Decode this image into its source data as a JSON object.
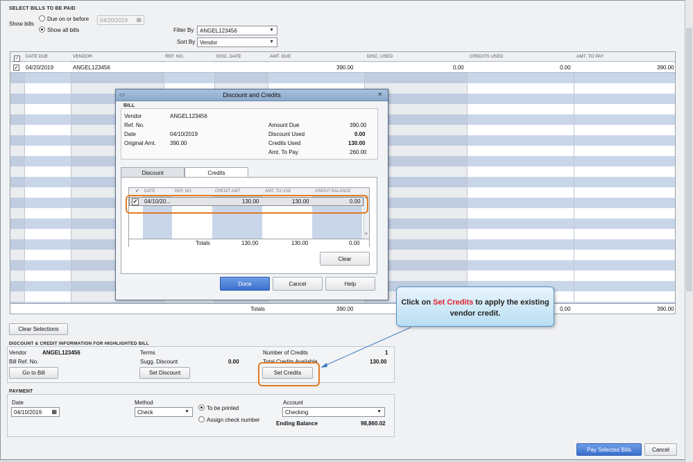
{
  "select_bills": {
    "title": "SELECT BILLS TO BE PAID",
    "show_bills_label": "Show bills",
    "due_option": "Due on or before",
    "due_date": "04/20/2019",
    "all_option": "Show all bills",
    "filter_label": "Filter By",
    "filter_value": "ANGEL123456",
    "sort_label": "Sort By",
    "sort_value": "Vendor"
  },
  "bills_table": {
    "columns": [
      "DATE DUE",
      "VENDOR",
      "REF. NO.",
      "DISC. DATE",
      "AMT. DUE",
      "DISC. USED",
      "CREDITS USED",
      "AMT. TO PAY"
    ],
    "row": {
      "checked": "✓",
      "date_due": "04/20/2019",
      "vendor": "ANGEL123456",
      "amt_due": "390.00",
      "disc_used": "0.00",
      "credits_used": "0.00",
      "amt_to_pay": "390.00"
    },
    "totals_label": "Totals",
    "total_amt_due": "390.00",
    "total_credits_used": "0.00",
    "total_amt_to_pay": "390.00"
  },
  "clear_selections_label": "Clear Selections",
  "discount_credit": {
    "title": "DISCOUNT & CREDIT INFORMATION FOR HIGHLIGHTED BILL",
    "vendor_label": "Vendor",
    "vendor_value": "ANGEL123456",
    "bill_ref_label": "Bill Ref. No.",
    "terms_label": "Terms",
    "sugg_discount_label": "Sugg. Discount",
    "sugg_discount_value": "0.00",
    "num_credits_label": "Number of Credits",
    "num_credits_value": "1",
    "total_credits_label": "Total Credits Available",
    "total_credits_value": "130.00",
    "go_to_bill": "Go to Bill",
    "set_discount": "Set Discount",
    "set_credits": "Set Credits"
  },
  "payment": {
    "title": "PAYMENT",
    "date_label": "Date",
    "date_value": "04/10/2019",
    "method_label": "Method",
    "method_value": "Check",
    "to_be_printed": "To be printed",
    "assign_check": "Assign check number",
    "account_label": "Account",
    "account_value": "Checking",
    "ending_balance_label": "Ending Balance",
    "ending_balance_value": "98,860.02"
  },
  "footer": {
    "pay_button": "Pay Selected Bills",
    "cancel_button": "Cancel"
  },
  "dialog": {
    "title": "Discount and Credits",
    "bill_section": "BILL",
    "vendor_label": "Vendor",
    "vendor_value": "ANGEL123456",
    "ref_label": "Ref. No.",
    "date_label": "Date",
    "date_value": "04/10/2019",
    "orig_label": "Original Amt.",
    "orig_value": "390.00",
    "amount_due_label": "Amount Due",
    "amount_due_value": "390.00",
    "discount_used_label": "Discount Used",
    "discount_used_value": "0.00",
    "credits_used_label": "Credits Used",
    "credits_used_value": "130.00",
    "amt_to_pay_label": "Amt. To Pay",
    "amt_to_pay_value": "260.00",
    "tabs": [
      "Discount",
      "Credits"
    ],
    "credit_columns": [
      "✓",
      "DATE",
      "REF. NO.",
      "CREDIT AMT.",
      "AMT. TO USE",
      "CREDIT BALANCE"
    ],
    "credit_row": {
      "check": "✔",
      "date": "04/10/20...",
      "credit_amt": "130.00",
      "amt_to_use": "130.00",
      "balance": "0.00"
    },
    "totals_label": "Totals",
    "totals": {
      "credit_amt": "130.00",
      "amt_to_use": "130.00",
      "balance": "0.00"
    },
    "clear": "Clear",
    "done": "Done",
    "cancel": "Cancel",
    "help": "Help"
  },
  "callout": {
    "prefix": "Click on",
    "highlight": "Set Credits",
    "suffix": "to apply the existing vendor credit."
  },
  "colors": {
    "callout_highlight": "#e0202a",
    "annotation_orange": "#e07b22",
    "row_stripe": "#c9d6ea"
  }
}
